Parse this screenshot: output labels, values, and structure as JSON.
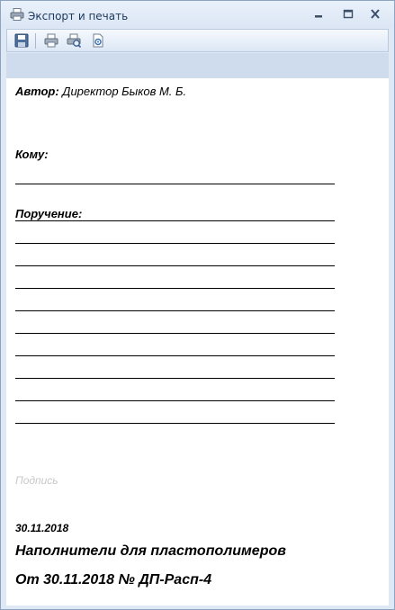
{
  "window": {
    "title": "Экспорт и печать"
  },
  "toolbar": {
    "buttons": [
      "save-icon",
      "print-icon",
      "print-preview-icon",
      "export-icon"
    ]
  },
  "document": {
    "author_label": "Автор:",
    "author_value": "Директор Быков М. Б.",
    "to_label": "Кому:",
    "task_label": "Поручение:",
    "signature_placeholder": "Подпись",
    "date": "30.11.2018",
    "subject": "Наполнители для пластополимеров",
    "reference": "От 30.11.2018 № ДП-Расп-4"
  },
  "colors": {
    "title_text": "#1e395b",
    "frame": "#dfe9f5",
    "band": "#cfdcee",
    "placeholder": "#c8c8c8"
  }
}
